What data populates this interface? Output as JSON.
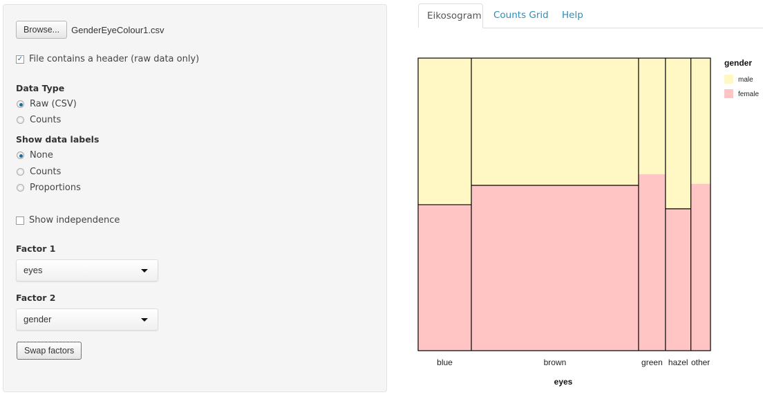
{
  "sidebar": {
    "browse_label": "Browse...",
    "file_name": "GenderEyeColour1.csv",
    "header_checkbox": {
      "label": "File contains a header (raw data only)",
      "checked": true
    },
    "data_type": {
      "label": "Data Type",
      "options": [
        {
          "label": "Raw (CSV)",
          "checked": true
        },
        {
          "label": "Counts",
          "checked": false
        }
      ]
    },
    "data_labels": {
      "label": "Show data labels",
      "options": [
        {
          "label": "None",
          "checked": true
        },
        {
          "label": "Counts",
          "checked": false
        },
        {
          "label": "Proportions",
          "checked": false
        }
      ]
    },
    "independence_checkbox": {
      "label": "Show independence",
      "checked": false
    },
    "factor1": {
      "label": "Factor 1",
      "value": "eyes"
    },
    "factor2": {
      "label": "Factor 2",
      "value": "gender"
    },
    "swap_label": "Swap factors"
  },
  "tabs": [
    {
      "label": "Eikosogram",
      "active": true
    },
    {
      "label": "Counts Grid",
      "active": false
    },
    {
      "label": "Help",
      "active": false
    }
  ],
  "chart_data": {
    "type": "eikosogram",
    "xlabel": "eyes",
    "legend_title": "gender",
    "legend_position": "right",
    "categories": [
      "blue",
      "brown",
      "green",
      "hazel",
      "other"
    ],
    "category_proportions": [
      0.182,
      0.572,
      0.092,
      0.087,
      0.066
    ],
    "series": [
      {
        "name": "male",
        "color": "#fff7c4",
        "values": [
          0.501,
          0.435,
          0.397,
          0.515,
          0.43
        ]
      },
      {
        "name": "female",
        "color": "#ffc4c4",
        "values": [
          0.499,
          0.565,
          0.603,
          0.485,
          0.57
        ]
      }
    ],
    "split_lines_drawn": [
      true,
      true,
      false,
      true,
      false
    ]
  }
}
